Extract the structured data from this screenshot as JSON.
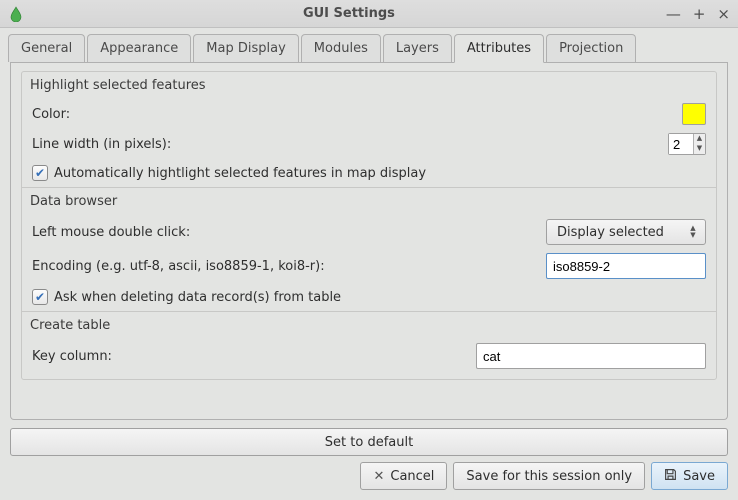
{
  "titlebar": {
    "title": "GUI Settings"
  },
  "tabs": [
    {
      "label": "General"
    },
    {
      "label": "Appearance"
    },
    {
      "label": "Map Display"
    },
    {
      "label": "Modules"
    },
    {
      "label": "Layers"
    },
    {
      "label": "Attributes"
    },
    {
      "label": "Projection"
    }
  ],
  "active_tab": "Attributes",
  "highlight": {
    "group_label": "Highlight selected features",
    "color_label": "Color:",
    "color_value": "#ffff00",
    "linewidth_label": "Line width (in pixels):",
    "linewidth_value": "2",
    "auto_label": "Automatically hightlight selected features in map display",
    "auto_checked": true
  },
  "databrowser": {
    "group_label": "Data browser",
    "leftclick_label": "Left mouse double click:",
    "leftclick_value": "Display selected",
    "encoding_label": "Encoding (e.g. utf-8, ascii, iso8859-1, koi8-r):",
    "encoding_value": "iso8859-2",
    "askdelete_label": "Ask when deleting data record(s) from table",
    "askdelete_checked": true
  },
  "createtable": {
    "group_label": "Create table",
    "keycol_label": "Key column:",
    "keycol_value": "cat"
  },
  "buttons": {
    "default": "Set to default",
    "cancel": "Cancel",
    "session": "Save for this session only",
    "save": "Save"
  }
}
